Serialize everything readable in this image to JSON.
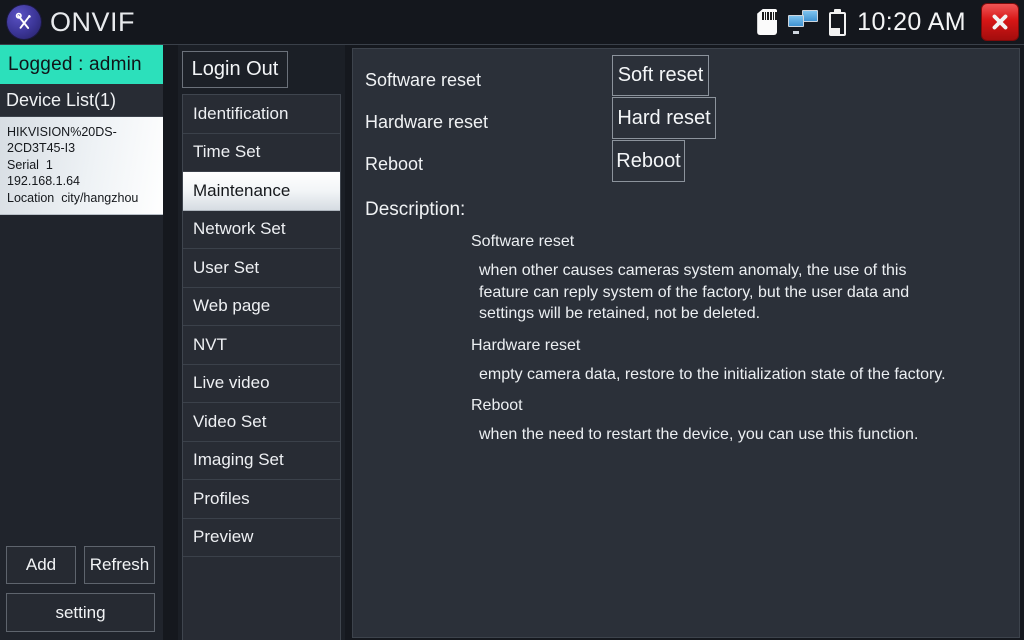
{
  "statusbar": {
    "brand_name": "ONVIF",
    "logo_icon": "tools-wrench-screwdriver-icon",
    "sd_icon": "sd-card-icon",
    "network_icon": "network-monitors-icon",
    "battery_icon": "battery-icon",
    "time": "10:20 AM",
    "close_icon": "close-x-icon"
  },
  "left_panel": {
    "logged_label": "Logged : admin",
    "device_list_header": "Device List(1)",
    "device": {
      "name": "HIKVISION%20DS-2CD3T45-I3",
      "serial": "Serial  1",
      "ip": "192.168.1.64",
      "location": "Location  city/hangzhou"
    },
    "buttons": {
      "add": "Add",
      "refresh": "Refresh",
      "setting": "setting"
    }
  },
  "menu_panel": {
    "login_out": "Login Out",
    "items": [
      {
        "label": "Identification",
        "selected": false
      },
      {
        "label": "Time Set",
        "selected": false
      },
      {
        "label": "Maintenance",
        "selected": true
      },
      {
        "label": "Network Set",
        "selected": false
      },
      {
        "label": "User Set",
        "selected": false
      },
      {
        "label": "Web page",
        "selected": false
      },
      {
        "label": "NVT",
        "selected": false
      },
      {
        "label": "Live video",
        "selected": false
      },
      {
        "label": "Video Set",
        "selected": false
      },
      {
        "label": "Imaging Set",
        "selected": false
      },
      {
        "label": "Profiles",
        "selected": false
      },
      {
        "label": "Preview",
        "selected": false
      }
    ]
  },
  "main_panel": {
    "rows": [
      {
        "label": "Software reset",
        "button": "Soft reset"
      },
      {
        "label": "Hardware reset",
        "button": "Hard reset"
      },
      {
        "label": "Reboot",
        "button": "Reboot"
      }
    ],
    "description_title": "Description:",
    "sections": [
      {
        "heading": "Software reset",
        "text": "when other causes cameras system anomaly, the use of this feature can reply system of the factory, but the user data and settings will be retained, not be deleted."
      },
      {
        "heading": "Hardware reset",
        "text": "empty camera data, restore to the initialization state of the factory."
      },
      {
        "heading": "Reboot",
        "text": "when the need to restart the device, you can use this function."
      }
    ]
  },
  "colors": {
    "accent_teal": "#2ce0bb",
    "panel_bg": "#2b3039",
    "menu_bg": "#282c34",
    "close_red": "#d61616"
  }
}
